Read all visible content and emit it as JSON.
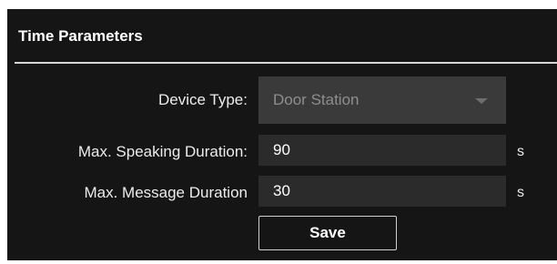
{
  "section": {
    "title": "Time Parameters"
  },
  "fields": {
    "device_type": {
      "label": "Device Type:",
      "value": "Door Station"
    },
    "max_speaking": {
      "label": "Max. Speaking Duration:",
      "value": "90",
      "unit": "s"
    },
    "max_message": {
      "label": "Max. Message Duration",
      "value": "30",
      "unit": "s"
    }
  },
  "actions": {
    "save_label": "Save"
  },
  "colors": {
    "panel_background": "#151515",
    "input_background": "#2b2b2b",
    "disabled_select_background": "#3a3a3a",
    "text": "#ececec"
  },
  "icons": {
    "select_caret": "chevron-down-icon"
  }
}
